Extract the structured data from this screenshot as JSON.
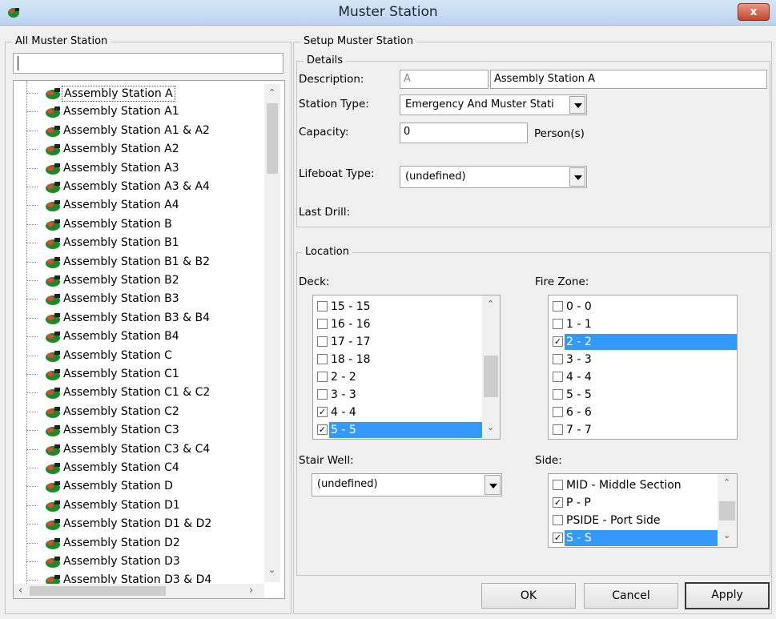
{
  "window": {
    "title": "Muster Station",
    "close_label": "x"
  },
  "left_panel": {
    "group_label": "All Muster Station",
    "search_value": "",
    "stations": [
      "Assembly Station A",
      "Assembly Station A1",
      "Assembly Station A1 & A2",
      "Assembly Station A2",
      "Assembly Station A3",
      "Assembly Station A3 & A4",
      "Assembly Station A4",
      "Assembly Station B",
      "Assembly Station B1",
      "Assembly Station B1 & B2",
      "Assembly Station B2",
      "Assembly Station B3",
      "Assembly Station B3 & B4",
      "Assembly Station B4",
      "Assembly Station C",
      "Assembly Station C1",
      "Assembly Station C1 & C2",
      "Assembly Station C2",
      "Assembly Station C3",
      "Assembly Station C3 & C4",
      "Assembly Station C4",
      "Assembly Station D",
      "Assembly Station D1",
      "Assembly Station D1 & D2",
      "Assembly Station D2",
      "Assembly Station D3",
      "Assembly Station D3 & D4"
    ],
    "selected_index": 0
  },
  "setup": {
    "group_label": "Setup Muster Station",
    "details": {
      "group_label": "Details",
      "description_label": "Description:",
      "description_code": "A",
      "description_value": "Assembly Station A",
      "station_type_label": "Station Type:",
      "station_type_value": "Emergency And Muster Stati",
      "capacity_label": "Capacity:",
      "capacity_value": "0",
      "capacity_unit": "Person(s)",
      "lifeboat_type_label": "Lifeboat Type:",
      "lifeboat_type_value": "(undefined)",
      "last_drill_label": "Last Drill:"
    },
    "location": {
      "group_label": "Location",
      "deck_label": "Deck:",
      "deck_items": [
        {
          "label": "15 - 15",
          "checked": false,
          "highlighted": false
        },
        {
          "label": "16 - 16",
          "checked": false,
          "highlighted": false
        },
        {
          "label": "17 - 17",
          "checked": false,
          "highlighted": false
        },
        {
          "label": "18 - 18",
          "checked": false,
          "highlighted": false
        },
        {
          "label": "2 - 2",
          "checked": false,
          "highlighted": false
        },
        {
          "label": "3 - 3",
          "checked": false,
          "highlighted": false
        },
        {
          "label": "4 - 4",
          "checked": true,
          "highlighted": false
        },
        {
          "label": "5 - 5",
          "checked": true,
          "highlighted": true
        }
      ],
      "fire_zone_label": "Fire Zone:",
      "fire_zone_items": [
        {
          "label": "0 - 0",
          "checked": false,
          "highlighted": false
        },
        {
          "label": "1 - 1",
          "checked": false,
          "highlighted": false
        },
        {
          "label": "2 - 2",
          "checked": true,
          "highlighted": true
        },
        {
          "label": "3 - 3",
          "checked": false,
          "highlighted": false
        },
        {
          "label": "4 - 4",
          "checked": false,
          "highlighted": false
        },
        {
          "label": "5 - 5",
          "checked": false,
          "highlighted": false
        },
        {
          "label": "6 - 6",
          "checked": false,
          "highlighted": false
        },
        {
          "label": "7 - 7",
          "checked": false,
          "highlighted": false
        }
      ],
      "stair_well_label": "Stair Well:",
      "stair_well_value": "(undefined)",
      "side_label": "Side:",
      "side_items": [
        {
          "label": "MID - Middle Section",
          "checked": false,
          "highlighted": false
        },
        {
          "label": "P - P",
          "checked": true,
          "highlighted": false
        },
        {
          "label": "PSIDE - Port Side",
          "checked": false,
          "highlighted": false
        },
        {
          "label": "S - S",
          "checked": true,
          "highlighted": true
        }
      ]
    }
  },
  "buttons": {
    "ok": "OK",
    "cancel": "Cancel",
    "apply": "Apply"
  },
  "colors": {
    "highlight": "#3399ff",
    "close": "#c5432a"
  }
}
